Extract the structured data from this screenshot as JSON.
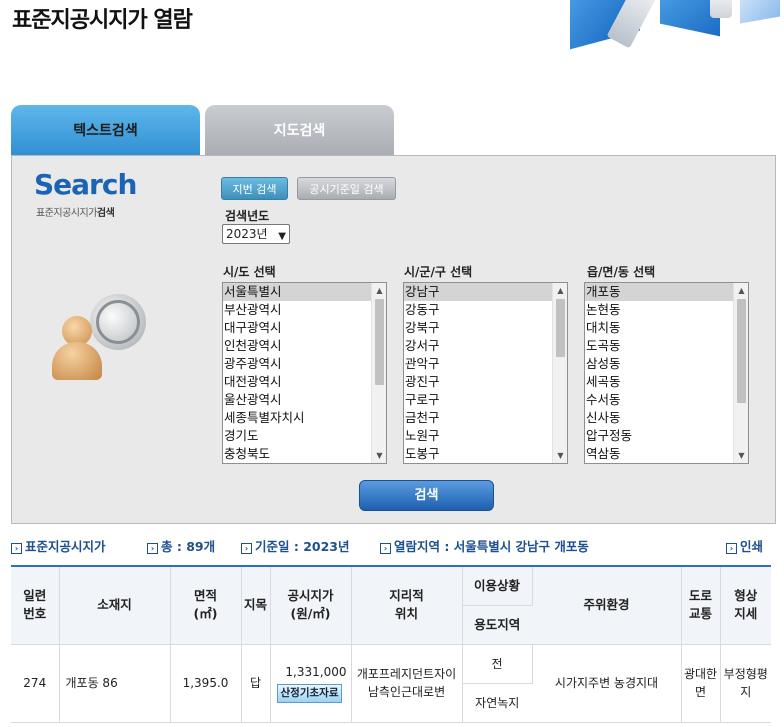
{
  "page": {
    "title": "표준지공시지가 열람"
  },
  "tabs": {
    "text_search": "텍스트검색",
    "map_search": "지도검색"
  },
  "search_panel": {
    "logo": "Search",
    "subtitle_prefix": "표준지공시지가",
    "subtitle_bold": "검색",
    "btn_jibun": "지번 검색",
    "btn_std_date": "공시기준일 검색",
    "year_label": "검색년도",
    "year_value": "2023년",
    "sido_label": "시/도 선택",
    "sigungu_label": "시/군/구 선택",
    "dong_label": "읍/면/동 선택",
    "sido_list": [
      "서울특별시",
      "부산광역시",
      "대구광역시",
      "인천광역시",
      "광주광역시",
      "대전광역시",
      "울산광역시",
      "세종특별자치시",
      "경기도",
      "충청북도"
    ],
    "sigungu_list": [
      "강남구",
      "강동구",
      "강북구",
      "강서구",
      "관악구",
      "광진구",
      "구로구",
      "금천구",
      "노원구",
      "도봉구"
    ],
    "dong_list": [
      "개포동",
      "논현동",
      "대치동",
      "도곡동",
      "삼성동",
      "세곡동",
      "수서동",
      "신사동",
      "압구정동",
      "역삼동"
    ],
    "search_button": "검색"
  },
  "info_bar": {
    "category": "표준지공시지가",
    "total": "총 : 89개",
    "std_date": "기준일 : 2023년",
    "region": "열람지역 : 서울특별시 강남구 개포동",
    "print": "인쇄"
  },
  "table": {
    "headers": {
      "serial": "일련\n번호",
      "location": "소재지",
      "area": "면적\n(㎡)",
      "jimok": "지목",
      "price": "공시지가\n(원/㎡)",
      "geo": "지리적\n위치",
      "usage": "이용상황",
      "zone": "용도지역",
      "env": "주위환경",
      "road": "도로\n교통",
      "shape": "형상\n지세"
    },
    "rows": [
      {
        "serial": "274",
        "location": "개포동 86",
        "area": "1,395.0",
        "jimok": "답",
        "price": "1,331,000",
        "base_btn": "산정기초자료",
        "geo": "개포프레지던트자이 남측인근대로변",
        "usage": "전",
        "zone": "자연녹지",
        "env": "시가지주변 농경지대",
        "road": "광대한면",
        "shape": "부정형평지"
      }
    ]
  }
}
